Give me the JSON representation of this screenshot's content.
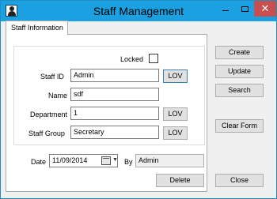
{
  "window": {
    "title": "Staff Management",
    "minimize_glyph": "",
    "close_glyph": "✕"
  },
  "tabs": [
    {
      "label": "Staff Information",
      "selected": true
    }
  ],
  "form": {
    "locked": {
      "label": "Locked",
      "checked": false
    },
    "staff_id": {
      "label": "Staff ID",
      "value": "Admin",
      "lov": "LOV"
    },
    "name": {
      "label": "Name",
      "value": "sdf"
    },
    "department": {
      "label": "Department",
      "value": "1",
      "lov": "LOV"
    },
    "staff_group": {
      "label": "Staff Group",
      "value": "Secretary",
      "lov": "LOV"
    },
    "date": {
      "label": "Date",
      "value": "11/09/2014"
    },
    "by": {
      "label": "By",
      "value": "Admin"
    }
  },
  "actions": {
    "create": "Create",
    "update": "Update",
    "search": "Search",
    "clear_form": "Clear Form",
    "delete": "Delete",
    "close": "Close"
  },
  "icons": [
    "staff-app-icon",
    "calendar-icon",
    "chevron-down-icon",
    "minimize-icon",
    "maximize-icon",
    "close-icon"
  ],
  "colors": {
    "titlebar": "#1ba1e2",
    "close_button": "#c74f4f",
    "window_bg": "#f0f0f0"
  }
}
